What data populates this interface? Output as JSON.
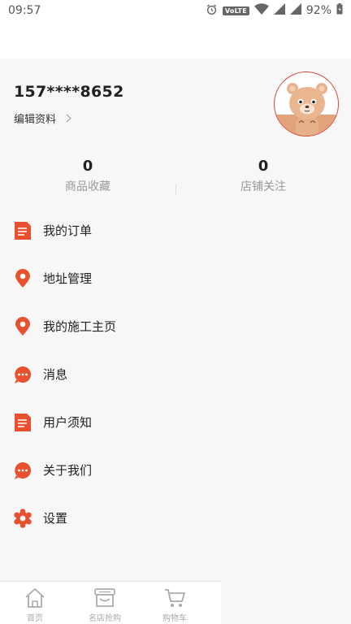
{
  "status_bar": {
    "time": "09:57",
    "network_badge": "VoLTE",
    "battery": "92%"
  },
  "profile": {
    "phone": "157****8652",
    "edit_label": "编辑资料",
    "avatar_icon": "bear-avatar-icon"
  },
  "stats": [
    {
      "value": "0",
      "label": "商品收藏"
    },
    {
      "value": "0",
      "label": "店铺关注"
    }
  ],
  "menu": [
    {
      "label": "我的订单",
      "icon": "document-icon"
    },
    {
      "label": "地址管理",
      "icon": "location-pin-icon"
    },
    {
      "label": "我的施工主页",
      "icon": "location-pin-icon"
    },
    {
      "label": "消息",
      "icon": "chat-bubble-icon"
    },
    {
      "label": "用户须知",
      "icon": "document-icon"
    },
    {
      "label": "关于我们",
      "icon": "chat-bubble-icon"
    },
    {
      "label": "设置",
      "icon": "gear-icon"
    }
  ],
  "tabbar": [
    {
      "label": "首页",
      "icon": "home-icon"
    },
    {
      "label": "名店抢购",
      "icon": "store-icon"
    },
    {
      "label": "购物车",
      "icon": "cart-icon"
    }
  ],
  "colors": {
    "accent": "#e8502e",
    "avatar_border": "#d9463b",
    "tab_inactive": "#aaaaaa"
  }
}
